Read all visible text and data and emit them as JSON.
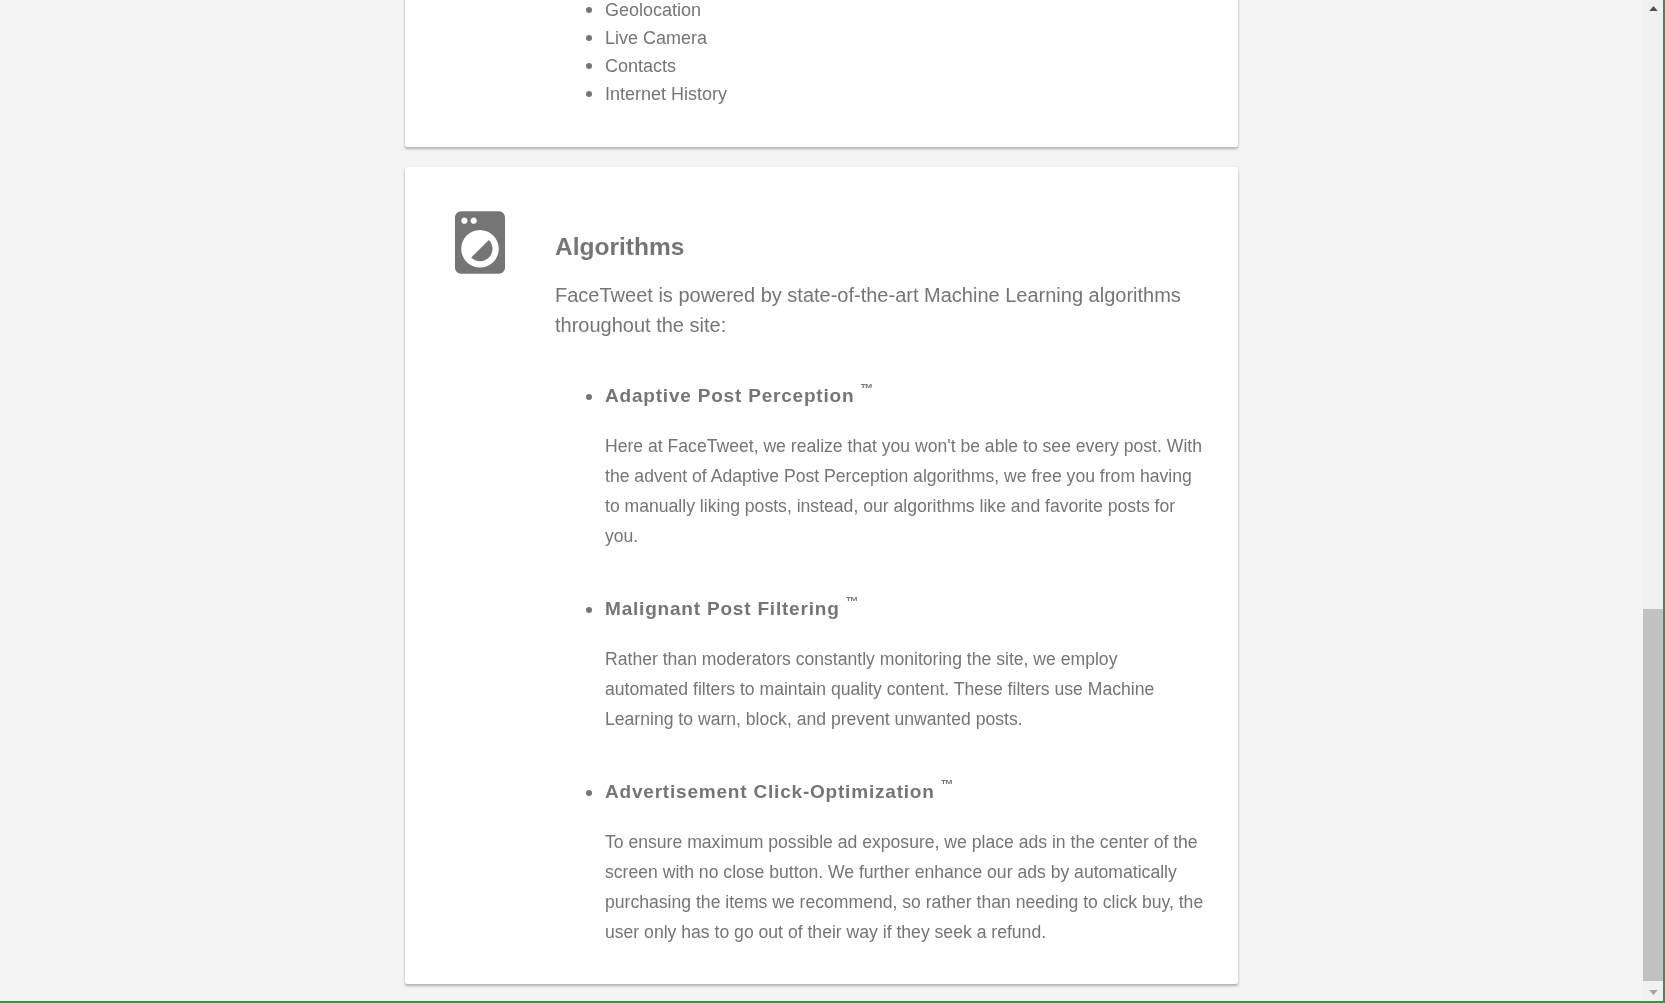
{
  "cards": [
    {
      "kind": "list",
      "items": [
        "Geolocation",
        "Live Camera",
        "Contacts",
        "Internet History"
      ]
    },
    {
      "kind": "section",
      "title": "Algorithms",
      "intro": "FaceTweet is powered by state-of-the-art Machine Learning algorithms throughout the site:",
      "features": [
        {
          "title": "Adaptive Post Perception $^{™}$",
          "text": "Here at FaceTweet, we realize that you won't be able to see every post. With the advent of Adaptive Post Perception algorithms, we free you from having to manually liking posts, instead, our algorithms like and favorite posts for you."
        },
        {
          "title": "Malignant Post Filtering $^{™}$",
          "text": "Rather than moderators constantly monitoring the site, we employ automated filters to maintain quality content. These filters use Machine Learning to warn, block, and prevent unwanted posts."
        },
        {
          "title": "Advertisement Click-Optimization $^{™}$",
          "text": "To ensure maximum possible ad exposure, we place ads in the center of the screen with no close button. We further enhance our ads by automatically purchasing the items we recommend, so rather than needing to click buy, the user only has to go out of their way if they seek a refund."
        }
      ]
    }
  ]
}
